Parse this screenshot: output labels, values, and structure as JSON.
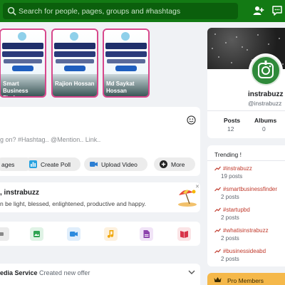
{
  "header": {
    "search_placeholder": "Search for people, pages, groups and #hashtags",
    "add_user_icon": "person-plus-icon",
    "messages_icon": "chat-bubble-icon"
  },
  "stories": [
    {
      "name": "Smart Business Finder"
    },
    {
      "name": "Rajion Hossan"
    },
    {
      "name": "Md Saykat Hossan"
    }
  ],
  "composer": {
    "placeholder": "g on? #Hashtag.. @Mention.. Link..",
    "actions": [
      {
        "label": "ages",
        "icon": "image-icon"
      },
      {
        "label": "Create Poll",
        "icon": "poll-icon"
      },
      {
        "label": "Upload Video",
        "icon": "video-icon"
      },
      {
        "label": "More",
        "icon": "more-icon"
      }
    ]
  },
  "greeting": {
    "title": ", instrabuzz",
    "subtitle": "n be light, blessed, enlightened, productive and happy.",
    "close": "✕"
  },
  "media_types": [
    "gif",
    "image",
    "video",
    "audio",
    "file",
    "book"
  ],
  "feed": {
    "item_bold": "edia Service",
    "item_rest": " Created new offer"
  },
  "profile": {
    "name": "instrabuzz",
    "handle": "@instrabuzz",
    "stats": [
      {
        "label": "Posts",
        "value": "12"
      },
      {
        "label": "Albums",
        "value": "0"
      }
    ]
  },
  "trending": {
    "title": "Trending !",
    "items": [
      {
        "tag": "#instrabuzz",
        "count": "19 posts"
      },
      {
        "tag": "#smartbusinessfinder",
        "count": "2 posts"
      },
      {
        "tag": "#startupbd",
        "count": "2 posts"
      },
      {
        "tag": "#whatisinstrabuzz",
        "count": "2 posts"
      },
      {
        "tag": "#businessideabd",
        "count": "2 posts"
      }
    ]
  },
  "pro_members": {
    "label": "Pro Members"
  },
  "colors": {
    "brand_green": "#137a14",
    "story_border": "#d8478c",
    "trending_red": "#c0392b",
    "pro_gold": "#f5b84a"
  }
}
